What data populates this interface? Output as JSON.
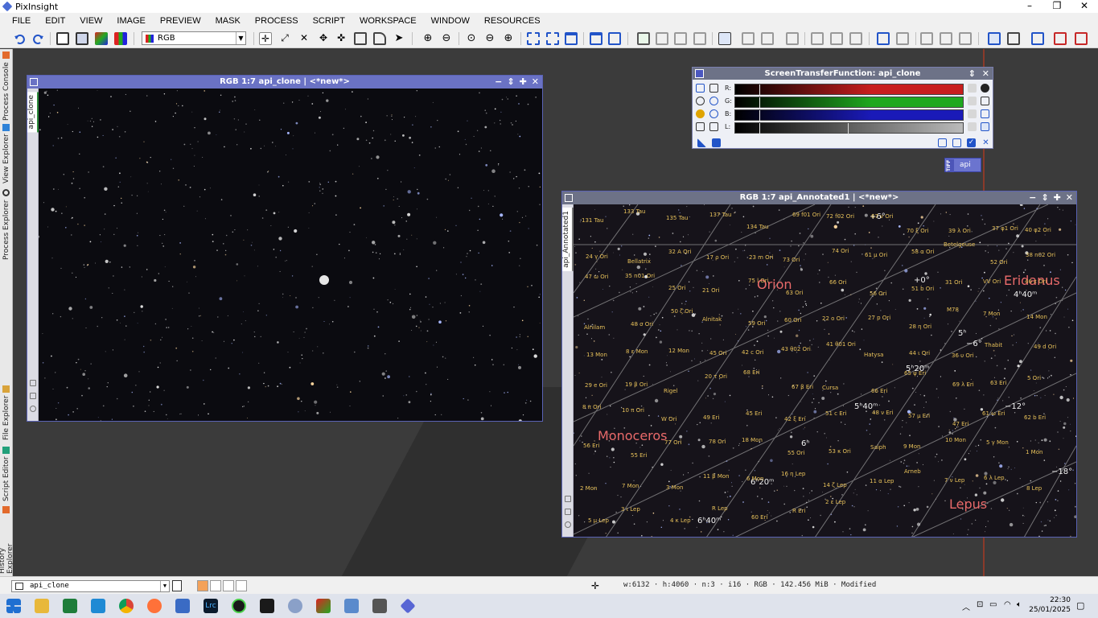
{
  "app": {
    "title": "PixInsight"
  },
  "menu": [
    "FILE",
    "EDIT",
    "VIEW",
    "IMAGE",
    "PREVIEW",
    "MASK",
    "PROCESS",
    "SCRIPT",
    "WORKSPACE",
    "WINDOW",
    "RESOURCES"
  ],
  "toolbar": {
    "color_mode": "RGB"
  },
  "dock_tabs": [
    "Process Console",
    "View Explorer",
    "Process Explorer",
    "File Explorer",
    "Script Editor",
    "History Explorer"
  ],
  "window1": {
    "title": "RGB 1:7 api_clone | <*new*>",
    "tab": "api_clone"
  },
  "window2": {
    "title": "RGB 1:7 api_Annotated1 | <*new*>",
    "tab": "api_Annotated1"
  },
  "stf": {
    "title": "ScreenTransferFunction: api_clone",
    "channels": [
      {
        "label": "R:",
        "color": "#c81e1e"
      },
      {
        "label": "G:",
        "color": "#1fa81f"
      },
      {
        "label": "B:",
        "color": "#1a1ab8"
      },
      {
        "label": "L:",
        "color": "#9a9a9a"
      }
    ]
  },
  "tiff_badge": {
    "type": "TIFF",
    "label": "api"
  },
  "annotations": {
    "constellations": [
      "Orion",
      "Eridanus",
      "Monoceros",
      "Lepus"
    ],
    "grid": [
      "+6°",
      "+0°",
      "4ʰ40ᵐ",
      "5ʰ",
      "−6°",
      "5ʰ20ᵐ",
      "5ʰ40ᵐ",
      "−12°",
      "6ʰ",
      "6ʰ20ᵐ",
      "−18°",
      "6ʰ40ᵐ"
    ],
    "stars": [
      "131 Tau",
      "133 Tau",
      "135 Tau",
      "137 Tau",
      "134 Tau",
      "69 f01 Ori",
      "72 f02 Ori",
      "67 ν Ori",
      "70 ξ Ori",
      "39 λ Ori",
      "37 φ1 Ori",
      "40 φ2 Ori",
      "24 γ Ori",
      "Bellatrix",
      "32 A Ori",
      "17 ρ Ori",
      "23 m Ori",
      "73 Ori",
      "74 Ori",
      "61 μ Ori",
      "58 α Ori",
      "Betelgeuse",
      "52 Ori",
      "38 n02 Ori",
      "47 ω Ori",
      "35 n01 Ori",
      "25 Ori",
      "21 Ori",
      "75 l Ori",
      "63 Ori",
      "66 Ori",
      "56 Ori",
      "51 b Ori",
      "31 Ori",
      "VV Ori",
      "46 ε Ori",
      "Alnilam",
      "48 σ Ori",
      "50 ζ Ori",
      "Alnitak",
      "59 Ori",
      "60 Ori",
      "22 o Ori",
      "27 p Ori",
      "28 η Ori",
      "M78",
      "7 Mon",
      "14 Mon",
      "13 Mon",
      "8 ε Mon",
      "12 Mon",
      "45 Ori",
      "42 c Ori",
      "43 θ02 Ori",
      "41 θ01 Ori",
      "Hatysa",
      "44 ι Ori",
      "36 υ Ori",
      "Thabit",
      "49 d Ori",
      "29 e Ori",
      "19 β Ori",
      "Rigel",
      "20 τ Ori",
      "68 Eri",
      "67 β Eri",
      "Cursa",
      "66 Eri",
      "65 ψ Eri",
      "69 λ Eri",
      "63 Eri",
      "5 Ori",
      "8 π Ori",
      "10 π Ori",
      "W Ori",
      "49 Eri",
      "45 Eri",
      "42 ξ Eri",
      "51 c Eri",
      "48 ν Eri",
      "57 μ Eri",
      "47 Eri",
      "61 ω Eri",
      "62 b Eri",
      "56 Eri",
      "55 Eri",
      "77 Ori",
      "78 Ori",
      "18 Mon",
      "55 Ori",
      "53 κ Ori",
      "Saiph",
      "9 Mon",
      "10 Mon",
      "5 γ Mon",
      "1 Mon",
      "2 Mon",
      "7 Mon",
      "3 Mon",
      "11 β Mon",
      "6 Mon",
      "16 η Lep",
      "14 ζ Lep",
      "11 α Lep",
      "Arneb",
      "7 ν Lep",
      "6 λ Lep",
      "8 Lep",
      "5 μ Lep",
      "3 ι Lep",
      "4 κ Lep",
      "R Lep",
      "60 Eri",
      "R Eri",
      "2 ε Lep"
    ]
  },
  "statusbar": {
    "view": "api_clone",
    "info": "w:6132 · h:4060 · n:3 · i16 · RGB · 142.456 MiB · Modified"
  },
  "clock": {
    "time": "22:30",
    "date": "25/01/2025"
  }
}
